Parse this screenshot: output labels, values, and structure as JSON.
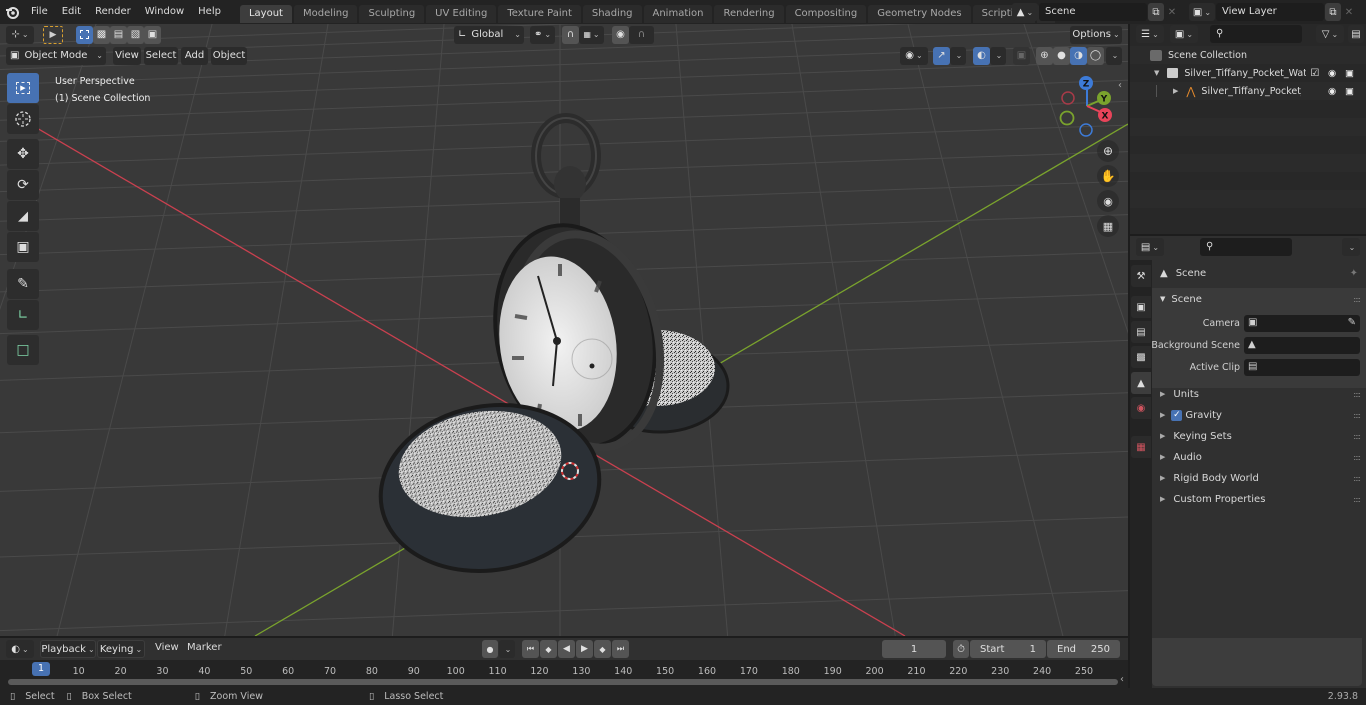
{
  "topbar": {
    "menus": [
      "File",
      "Edit",
      "Render",
      "Window",
      "Help"
    ],
    "workspace_tabs": [
      "Layout",
      "Modeling",
      "Sculpting",
      "UV Editing",
      "Texture Paint",
      "Shading",
      "Animation",
      "Rendering",
      "Compositing",
      "Geometry Nodes",
      "Scripting"
    ],
    "active_tab": "Layout",
    "add_tab": "+",
    "scene_name": "Scene",
    "view_layer_name": "View Layer"
  },
  "viewport": {
    "mode": "Object Mode",
    "menus": [
      "View",
      "Select",
      "Add",
      "Object"
    ],
    "transform_orientation": "Global",
    "options_label": "Options",
    "overlay_title": "User Perspective",
    "overlay_subtitle": "(1) Scene Collection",
    "gizmo_axes": {
      "x": "X",
      "y": "Y",
      "z": "Z"
    },
    "colors": {
      "x_axis": "#c9404f",
      "y_axis": "#7aa32d",
      "grid": "#4a4a4a",
      "accent": "#4772b3"
    }
  },
  "toolbar": {
    "tools": [
      "select-box",
      "cursor",
      "move",
      "rotate",
      "scale",
      "transform",
      "annotate",
      "measure",
      "add-cube"
    ]
  },
  "outliner": {
    "root": "Scene Collection",
    "items": [
      {
        "label": "Silver_Tiffany_Pocket_Watch_",
        "type": "collection",
        "checked": true
      },
      {
        "label": "Silver_Tiffany_Pocket_Wa",
        "type": "object"
      }
    ]
  },
  "properties": {
    "context": "Scene",
    "panel_title": "Scene",
    "fields": [
      {
        "label": "Camera",
        "value": ""
      },
      {
        "label": "Background Scene",
        "value": ""
      },
      {
        "label": "Active Clip",
        "value": ""
      }
    ],
    "panels": [
      "Units",
      "Gravity",
      "Keying Sets",
      "Audio",
      "Rigid Body World",
      "Custom Properties"
    ],
    "gravity_checked": true
  },
  "timeline": {
    "menus": [
      "Playback",
      "Keying",
      "View",
      "Marker"
    ],
    "current_frame": "1",
    "start_label": "Start",
    "start_value": "1",
    "end_label": "End",
    "end_value": "250",
    "ticks": [
      "10",
      "20",
      "30",
      "40",
      "50",
      "60",
      "70",
      "80",
      "90",
      "100",
      "110",
      "120",
      "130",
      "140",
      "150",
      "160",
      "170",
      "180",
      "190",
      "200",
      "210",
      "220",
      "230",
      "240",
      "250"
    ],
    "playhead": "1"
  },
  "statusbar": {
    "hints": [
      "Select",
      "Box Select",
      "Zoom View",
      "Lasso Select"
    ],
    "version": "2.93.8"
  }
}
